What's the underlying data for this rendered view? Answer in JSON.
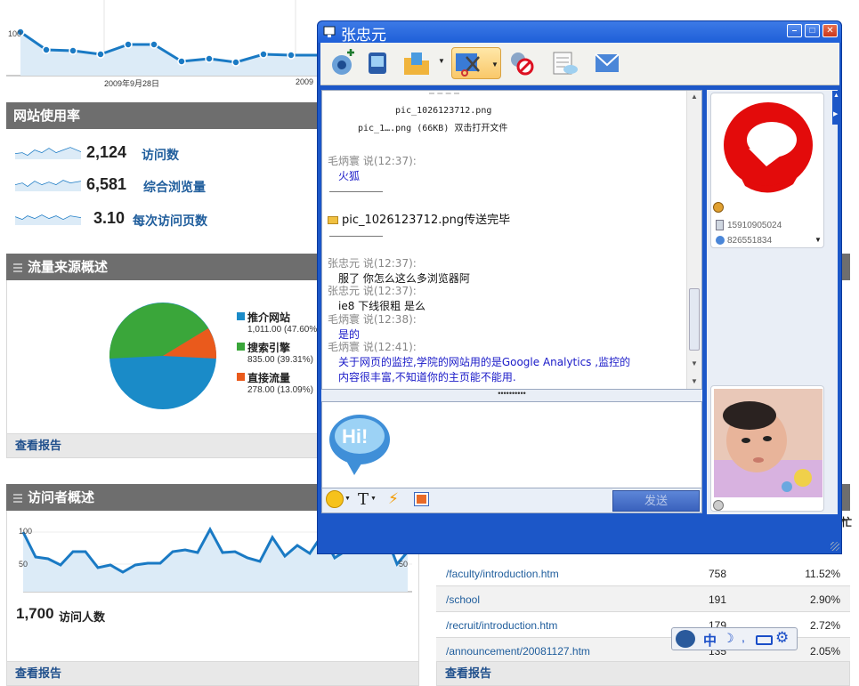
{
  "top_chart": {
    "y_label": "100",
    "date_labels": [
      "2009年9月28日",
      "2009"
    ]
  },
  "usage": {
    "title": "网站使用率",
    "stats": [
      {
        "value": "2,124",
        "label": "访问数"
      },
      {
        "value": "6,581",
        "label": "综合浏览量"
      },
      {
        "value": "3.10",
        "label": "每次访问页数"
      }
    ]
  },
  "traffic": {
    "title": "流量来源概述",
    "footer": "查看报告",
    "colors": {
      "referral": "#1a8bc8",
      "search": "#3aa63a",
      "direct": "#ea5a1c"
    },
    "legend": [
      {
        "name": "推介网站",
        "value": "1,011.00 (47.60%)"
      },
      {
        "name": "搜索引擎",
        "value": "835.00 (39.31%)"
      },
      {
        "name": "直接流量",
        "value": "278.00 (13.09%)"
      }
    ]
  },
  "visitors": {
    "title": "访问者概述",
    "footer": "查看报告",
    "y_top": "100",
    "y_mid": "50",
    "y_mid_right": "50",
    "count": "1,700",
    "count_label": "访问人数"
  },
  "table": {
    "rows": [
      {
        "page": "/faculty/introduction.htm",
        "views": "758",
        "pct": "11.52%"
      },
      {
        "page": "/school",
        "views": "191",
        "pct": "2.90%"
      },
      {
        "page": "/recruit/introduction.htm",
        "views": "179",
        "pct": "2.72%"
      },
      {
        "page": "/announcement/20081127.htm",
        "views": "135",
        "pct": "2.05%"
      }
    ],
    "footer": "查看报告",
    "edge_char": "忙"
  },
  "chat": {
    "title": "张忠元",
    "file_name": "pic_1026123712.png",
    "file_info": "pic_1….png  (66KB) 双击打开文件",
    "messages": [
      {
        "sender": "毛炳寰  说(12:37):",
        "text": "火狐"
      },
      {
        "sender": "",
        "text": "pic_1026123712.png传送完毕"
      },
      {
        "sender": "张忠元  说(12:37):",
        "text": "服了 你怎么这么多浏览器阿"
      },
      {
        "sender": "张忠元  说(12:37):",
        "text": "ie8  下线很粗 是么"
      },
      {
        "sender": "毛炳寰  说(12:38):",
        "text": "是的"
      },
      {
        "sender": "毛炳寰  说(12:41):",
        "text": "关于网页的监控,学院的网站用的是Google Analytics ,监控的",
        "text2": "内容很丰富,不知道你的主页能不能用."
      }
    ],
    "send_label": "发送",
    "phone": "15910905024",
    "qq": "826551834",
    "hi_text": "Hi!"
  },
  "ime": {
    "label": "中"
  }
}
